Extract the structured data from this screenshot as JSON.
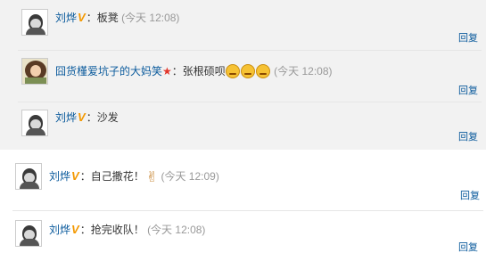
{
  "comments": [
    {
      "user": "刘烨",
      "colon": "：",
      "text": "板凳",
      "time": "(今天 12:08)",
      "reply": "回复"
    },
    {
      "user": "囧货槿爱坑子的大妈笑",
      "colon": "：",
      "text": "张根硕呗",
      "time": "(今天 12:08)",
      "reply": "回复"
    },
    {
      "user": "刘烨",
      "colon": "：",
      "text": "沙发",
      "time": "(今天 12:08)",
      "reply": "回复"
    },
    {
      "user": "刘烨",
      "colon": "：",
      "text": "自己撒花！",
      "time": "(今天 12:09)",
      "reply": "回复"
    },
    {
      "user": "刘烨",
      "colon": "：",
      "text": "抢完收队！",
      "time": "(今天 12:08)",
      "reply": "回复"
    }
  ],
  "badges": {
    "verified": "V",
    "star": "★",
    "victory_hand": "✌"
  },
  "colors": {
    "name": "#0a5a9c",
    "verified": "#f39800",
    "time": "#999999",
    "panel_bg": "#f2f2f2"
  }
}
